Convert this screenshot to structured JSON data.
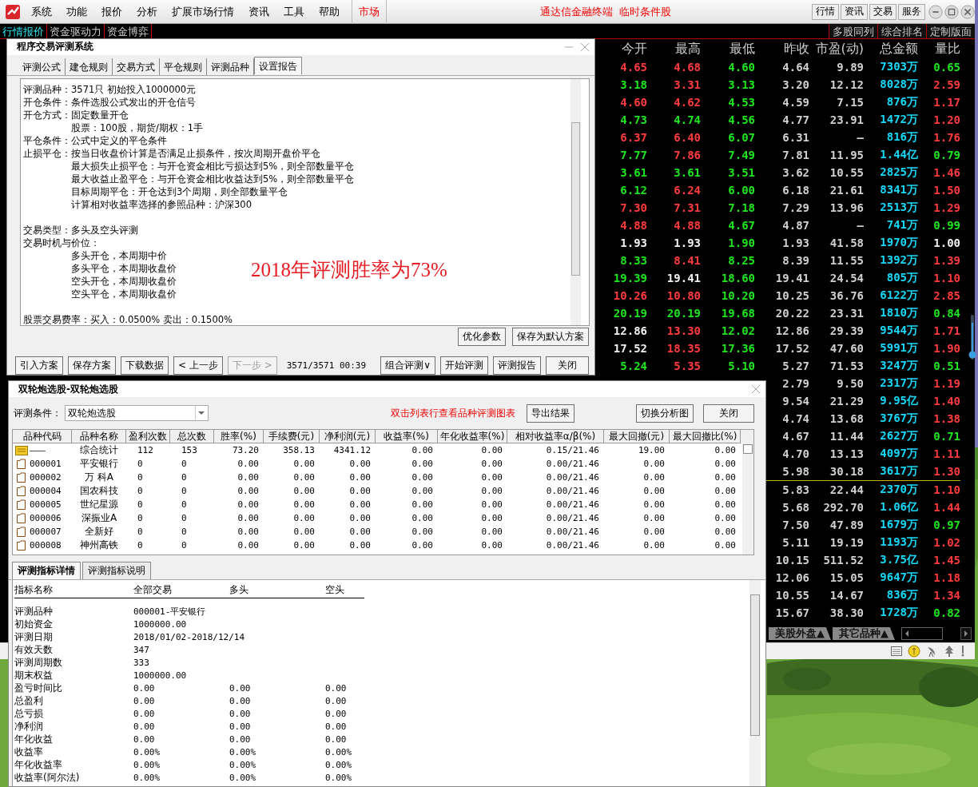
{
  "menu_bar": {
    "items": [
      "系统",
      "功能",
      "报价",
      "分析",
      "扩展市场行情",
      "资讯",
      "工具",
      "帮助"
    ],
    "market": "市场",
    "title": "通达信金融终端",
    "subtitle": "临时条件股",
    "buttons": [
      "行情",
      "资讯",
      "交易",
      "服务"
    ]
  },
  "view_tabs": [
    {
      "label": "行情报价",
      "selected": true
    },
    {
      "label": "资金驱动力",
      "selected": false
    },
    {
      "label": "资金博弈",
      "selected": false
    }
  ],
  "view_buttons": [
    "多股同列",
    "综合排名",
    "定制版面"
  ],
  "quote_table": {
    "columns": [
      "今开",
      "最高",
      "最低",
      "昨收",
      "市盈(动)",
      "总金额",
      "量比"
    ],
    "row_groups": [
      [
        {
          "open": {
            "text": "4.65",
            "color": "#ff3b3b"
          },
          "high": {
            "text": "4.68",
            "color": "#ff3b3b"
          },
          "low": {
            "text": "4.60",
            "color": "#1ee61e"
          },
          "prev_close": "4.64",
          "pe": "9.89",
          "amount": "7303万",
          "ratio": {
            "text": "0.65",
            "color": "#1ee61e"
          }
        },
        {
          "open": {
            "text": "3.18",
            "color": "#1ee61e"
          },
          "high": {
            "text": "3.31",
            "color": "#ff3b3b"
          },
          "low": {
            "text": "3.13",
            "color": "#1ee61e"
          },
          "prev_close": "3.20",
          "pe": "12.12",
          "amount": "8028万",
          "ratio": {
            "text": "2.59",
            "color": "#ff3b3b"
          }
        },
        {
          "open": {
            "text": "4.60",
            "color": "#ff3b3b"
          },
          "high": {
            "text": "4.62",
            "color": "#ff3b3b"
          },
          "low": {
            "text": "4.53",
            "color": "#1ee61e"
          },
          "prev_close": "4.59",
          "pe": "7.15",
          "amount": "876万",
          "ratio": {
            "text": "1.17",
            "color": "#ff3b3b"
          }
        },
        {
          "open": {
            "text": "4.73",
            "color": "#1ee61e"
          },
          "high": {
            "text": "4.74",
            "color": "#1ee61e"
          },
          "low": {
            "text": "4.56",
            "color": "#1ee61e"
          },
          "prev_close": "4.77",
          "pe": "23.91",
          "amount": "1472万",
          "ratio": {
            "text": "1.20",
            "color": "#ff3b3b"
          }
        },
        {
          "open": {
            "text": "6.37",
            "color": "#ff3b3b"
          },
          "high": {
            "text": "6.40",
            "color": "#ff3b3b"
          },
          "low": {
            "text": "6.07",
            "color": "#1ee61e"
          },
          "prev_close": "6.31",
          "pe": "—",
          "amount": "816万",
          "ratio": {
            "text": "1.76",
            "color": "#ff3b3b"
          }
        },
        {
          "open": {
            "text": "7.77",
            "color": "#1ee61e"
          },
          "high": {
            "text": "7.86",
            "color": "#ff3b3b"
          },
          "low": {
            "text": "7.49",
            "color": "#1ee61e"
          },
          "prev_close": "7.81",
          "pe": "11.95",
          "amount": "1.44亿",
          "ratio": {
            "text": "0.79",
            "color": "#1ee61e"
          }
        },
        {
          "open": {
            "text": "3.61",
            "color": "#1ee61e"
          },
          "high": {
            "text": "3.61",
            "color": "#1ee61e"
          },
          "low": {
            "text": "3.51",
            "color": "#1ee61e"
          },
          "prev_close": "3.62",
          "pe": "10.55",
          "amount": "2825万",
          "ratio": {
            "text": "1.46",
            "color": "#ff3b3b"
          }
        },
        {
          "open": {
            "text": "6.12",
            "color": "#1ee61e"
          },
          "high": {
            "text": "6.24",
            "color": "#ff3b3b"
          },
          "low": {
            "text": "6.00",
            "color": "#1ee61e"
          },
          "prev_close": "6.18",
          "pe": "21.61",
          "amount": "8341万",
          "ratio": {
            "text": "1.50",
            "color": "#ff3b3b"
          }
        },
        {
          "open": {
            "text": "7.30",
            "color": "#ff3b3b"
          },
          "high": {
            "text": "7.31",
            "color": "#ff3b3b"
          },
          "low": {
            "text": "7.18",
            "color": "#1ee61e"
          },
          "prev_close": "7.29",
          "pe": "13.96",
          "amount": "2513万",
          "ratio": {
            "text": "1.29",
            "color": "#ff3b3b"
          }
        },
        {
          "open": {
            "text": "4.88",
            "color": "#ff3b3b"
          },
          "high": {
            "text": "4.88",
            "color": "#ff3b3b"
          },
          "low": {
            "text": "4.67",
            "color": "#1ee61e"
          },
          "prev_close": "4.87",
          "pe": "—",
          "amount": "741万",
          "ratio": {
            "text": "0.99",
            "color": "#1ee61e"
          }
        },
        {
          "open": {
            "text": "1.93",
            "color": "#f0f0f0"
          },
          "high": {
            "text": "1.93",
            "color": "#f0f0f0"
          },
          "low": {
            "text": "1.90",
            "color": "#1ee61e"
          },
          "prev_close": "1.93",
          "pe": "41.58",
          "amount": "1970万",
          "ratio": {
            "text": "1.00",
            "color": "#f0f0f0"
          }
        },
        {
          "open": {
            "text": "8.33",
            "color": "#1ee61e"
          },
          "high": {
            "text": "8.41",
            "color": "#ff3b3b"
          },
          "low": {
            "text": "8.25",
            "color": "#1ee61e"
          },
          "prev_close": "8.39",
          "pe": "11.55",
          "amount": "1392万",
          "ratio": {
            "text": "1.39",
            "color": "#ff3b3b"
          }
        },
        {
          "open": {
            "text": "19.39",
            "color": "#1ee61e"
          },
          "high": {
            "text": "19.41",
            "color": "#f0f0f0"
          },
          "low": {
            "text": "18.60",
            "color": "#1ee61e"
          },
          "prev_close": "19.41",
          "pe": "24.54",
          "amount": "805万",
          "ratio": {
            "text": "1.10",
            "color": "#ff3b3b"
          }
        },
        {
          "open": {
            "text": "10.26",
            "color": "#ff3b3b"
          },
          "high": {
            "text": "10.80",
            "color": "#ff3b3b"
          },
          "low": {
            "text": "10.20",
            "color": "#1ee61e"
          },
          "prev_close": "10.25",
          "pe": "36.76",
          "amount": "6122万",
          "ratio": {
            "text": "2.85",
            "color": "#ff3b3b"
          }
        },
        {
          "open": {
            "text": "20.19",
            "color": "#1ee61e"
          },
          "high": {
            "text": "20.19",
            "color": "#1ee61e"
          },
          "low": {
            "text": "19.68",
            "color": "#1ee61e"
          },
          "prev_close": "20.22",
          "pe": "23.31",
          "amount": "1810万",
          "ratio": {
            "text": "0.84",
            "color": "#1ee61e"
          }
        },
        {
          "open": {
            "text": "12.86",
            "color": "#f0f0f0"
          },
          "high": {
            "text": "13.30",
            "color": "#ff3b3b"
          },
          "low": {
            "text": "12.02",
            "color": "#1ee61e"
          },
          "prev_close": "12.86",
          "pe": "29.39",
          "amount": "9544万",
          "ratio": {
            "text": "1.71",
            "color": "#ff3b3b"
          }
        },
        {
          "open": {
            "text": "17.52",
            "color": "#f0f0f0"
          },
          "high": {
            "text": "18.35",
            "color": "#ff3b3b"
          },
          "low": {
            "text": "17.36",
            "color": "#1ee61e"
          },
          "prev_close": "17.52",
          "pe": "47.60",
          "amount": "5991万",
          "ratio": {
            "text": "1.90",
            "color": "#ff3b3b"
          }
        },
        {
          "open": {
            "text": "5.24",
            "color": "#1ee61e"
          },
          "high": {
            "text": "5.35",
            "color": "#ff3b3b"
          },
          "low": {
            "text": "5.10",
            "color": "#1ee61e"
          },
          "prev_close": "5.27",
          "pe": "71.53",
          "amount": "3247万",
          "ratio": {
            "text": "0.51",
            "color": "#1ee61e"
          }
        },
        {
          "prev_close": "2.79",
          "pe": "9.50",
          "amount": "2317万",
          "ratio": {
            "text": "1.19",
            "color": "#ff3b3b"
          }
        },
        {
          "prev_close": "9.54",
          "pe": "21.29",
          "amount": "9.95亿",
          "ratio": {
            "text": "1.40",
            "color": "#ff3b3b"
          }
        },
        {
          "prev_close": "4.74",
          "pe": "13.68",
          "amount": "3767万",
          "ratio": {
            "text": "1.38",
            "color": "#ff3b3b"
          }
        },
        {
          "prev_close": "4.67",
          "pe": "11.44",
          "amount": "2627万",
          "ratio": {
            "text": "0.71",
            "color": "#1ee61e"
          }
        },
        {
          "prev_close": "4.70",
          "pe": "13.13",
          "amount": "4097万",
          "ratio": {
            "text": "1.11",
            "color": "#ff3b3b"
          }
        },
        {
          "prev_close": "5.98",
          "pe": "30.18",
          "amount": "3617万",
          "ratio": {
            "text": "1.30",
            "color": "#ff3b3b"
          }
        }
      ],
      [
        {
          "prev_close": "5.83",
          "pe": "22.44",
          "amount": "2370万",
          "ratio": {
            "text": "1.10",
            "color": "#ff3b3b"
          }
        },
        {
          "prev_close": "5.68",
          "pe": "292.70",
          "amount": "1.06亿",
          "ratio": {
            "text": "1.44",
            "color": "#ff3b3b"
          }
        },
        {
          "prev_close": "7.50",
          "pe": "47.89",
          "amount": "1679万",
          "ratio": {
            "text": "0.97",
            "color": "#1ee61e"
          }
        },
        {
          "prev_close": "5.11",
          "pe": "19.19",
          "amount": "1193万",
          "ratio": {
            "text": "1.02",
            "color": "#ff3b3b"
          }
        },
        {
          "prev_close": "10.15",
          "pe": "511.52",
          "amount": "3.75亿",
          "ratio": {
            "text": "1.45",
            "color": "#ff3b3b"
          }
        },
        {
          "prev_close": "12.06",
          "pe": "15.05",
          "amount": "9647万",
          "ratio": {
            "text": "1.18",
            "color": "#ff3b3b"
          }
        },
        {
          "prev_close": "10.55",
          "pe": "14.67",
          "amount": "836万",
          "ratio": {
            "text": "1.34",
            "color": "#ff3b3b"
          }
        },
        {
          "prev_close": "15.67",
          "pe": "38.30",
          "amount": "1728万",
          "ratio": {
            "text": "0.82",
            "color": "#1ee61e"
          }
        }
      ]
    ]
  },
  "market_tabs": [
    "美股外盘▲",
    "其它品种▲"
  ],
  "eval_window": {
    "title": "程序交易评测系统",
    "tabs": [
      {
        "label": "评测公式",
        "selected": false
      },
      {
        "label": "建仓规则",
        "selected": false
      },
      {
        "label": "交易方式",
        "selected": false
      },
      {
        "label": "平仓规则",
        "selected": false
      },
      {
        "label": "评测品种",
        "selected": false
      },
      {
        "label": "设置报告",
        "selected": true
      }
    ],
    "report_sections": [
      [
        {
          "text": "评测品种：3571只 初始投入1000000元"
        },
        {
          "text": "开仓条件：条件选股公式发出的开仓信号"
        },
        {
          "text": "开仓方式：固定数量开仓",
          "children": [
            {
              "text": "股票：100股，期货/期权：1手"
            }
          ]
        },
        {
          "text": "平仓条件：公式中定义的平仓条件"
        },
        {
          "text": "止损平仓：按当日收盘价计算是否满足止损条件，按次周期开盘价平仓",
          "children": [
            {
              "text": "最大损失止损平仓：与开仓资金相比亏损达到5%，则全部数量平仓"
            },
            {
              "text": "最大收益止盈平仓：与开仓资金相比收益达到5%，则全部数量平仓"
            },
            {
              "text": "目标周期平仓：开仓达到3个周期，则全部数量平仓"
            },
            {
              "text": "计算相对收益率选择的参照品种：沪深300"
            }
          ]
        }
      ],
      [
        {
          "text": "交易类型：多头及空头评测"
        },
        {
          "text": "交易时机与价位：",
          "children": [
            {
              "text": "多头开仓，本周期中价"
            },
            {
              "text": "多头平仓，本周期收盘价"
            },
            {
              "text": "空头开仓，本周期收盘价"
            },
            {
              "text": "空头平仓，本周期收盘价"
            }
          ]
        }
      ],
      [
        {
          "text": "股票交易费率：买入：0.0500%  卖出：0.1500%"
        }
      ]
    ],
    "annotation": "2018年评测胜率为73%",
    "panel_buttons": [
      "优化参数",
      "保存为默认方案"
    ],
    "toolbar": [
      {
        "label": "引入方案",
        "disabled": false
      },
      {
        "label": "保存方案",
        "disabled": false
      },
      {
        "label": "下载数据",
        "disabled": false
      },
      {
        "label": "< 上一步",
        "disabled": false
      },
      {
        "label": "下一步 >",
        "disabled": true
      }
    ],
    "progress": "3571/3571 00:39",
    "actions": [
      "组合评测∨",
      "开始评测",
      "评测报告",
      "关闭"
    ]
  },
  "select_window": {
    "title": "双轮炮选股-双轮炮选股",
    "condition_label": "评测条件：",
    "condition_value": "双轮炮选股",
    "hint": "双击列表行查看品种评测图表",
    "export_button": "导出结果",
    "right_buttons": [
      "切换分析图",
      "关闭"
    ],
    "columns": [
      "品种代码",
      "品种名称",
      "盈利次数",
      "总次数",
      "胜率(%)",
      "手续费(元)",
      "净利润(元)",
      "收益率(%)",
      "年化收益率(%)",
      "相对收益率α/β(%)",
      "最大回撤(元)",
      "最大回撤比(%)"
    ],
    "rows": [
      {
        "kind": "summary",
        "cells": [
          "———",
          "综合统计",
          "112",
          "153",
          "73.20",
          "358.13",
          "4341.12",
          "0.00",
          "0.00",
          "0.15/21.46",
          "19.00",
          "0.00"
        ]
      },
      {
        "kind": "stock",
        "cells": [
          "000001",
          "平安银行",
          "0",
          "0",
          "0.00",
          "0.00",
          "0.00",
          "0.00",
          "0.00",
          "0.00/21.46",
          "0.00",
          "0.00"
        ]
      },
      {
        "kind": "stock",
        "cells": [
          "000002",
          "万 科A",
          "0",
          "0",
          "0.00",
          "0.00",
          "0.00",
          "0.00",
          "0.00",
          "0.00/21.46",
          "0.00",
          "0.00"
        ]
      },
      {
        "kind": "stock",
        "cells": [
          "000004",
          "国农科技",
          "0",
          "0",
          "0.00",
          "0.00",
          "0.00",
          "0.00",
          "0.00",
          "0.00/21.46",
          "0.00",
          "0.00"
        ]
      },
      {
        "kind": "stock",
        "cells": [
          "000005",
          "世纪星源",
          "0",
          "0",
          "0.00",
          "0.00",
          "0.00",
          "0.00",
          "0.00",
          "0.00/21.46",
          "0.00",
          "0.00"
        ]
      },
      {
        "kind": "stock",
        "cells": [
          "000006",
          "深振业A",
          "0",
          "0",
          "0.00",
          "0.00",
          "0.00",
          "0.00",
          "0.00",
          "0.00/21.46",
          "0.00",
          "0.00"
        ]
      },
      {
        "kind": "stock",
        "cells": [
          "000007",
          "全新好",
          "0",
          "0",
          "0.00",
          "0.00",
          "0.00",
          "0.00",
          "0.00",
          "0.00/21.46",
          "0.00",
          "0.00"
        ]
      },
      {
        "kind": "stock",
        "cells": [
          "000008",
          "神州高铁",
          "0",
          "0",
          "0.00",
          "0.00",
          "0.00",
          "0.00",
          "0.00",
          "0.00/21.46",
          "0.00",
          "0.00"
        ]
      }
    ],
    "detail_tabs": [
      {
        "label": "评测指标详情",
        "selected": true
      },
      {
        "label": "评测指标说明",
        "selected": false
      }
    ],
    "detail_columns": [
      "指标名称",
      "全部交易",
      "多头",
      "空头"
    ],
    "detail_rows": [
      [
        "评测品种",
        "000001-平安银行"
      ],
      [
        "初始资金",
        "1000000.00"
      ],
      [
        "评测日期",
        "2018/01/02-2018/12/14"
      ],
      [
        "有效天数",
        "347"
      ],
      [
        "评测周期数",
        "333"
      ],
      [
        "期末权益",
        "1000000.00"
      ],
      [
        "盈亏时间比",
        "0.00",
        "0.00",
        "0.00"
      ],
      [
        "总盈利",
        "0.00",
        "0.00",
        "0.00"
      ],
      [
        "总亏损",
        "0.00",
        "0.00",
        "0.00"
      ],
      [
        "净利润",
        "0.00",
        "0.00",
        "0.00"
      ],
      [
        "年化收益",
        "0.00",
        "0.00",
        "0.00"
      ],
      [
        "收益率",
        "0.00%",
        "0.00%",
        "0.00%"
      ],
      [
        "年化收益率",
        "0.00%",
        "0.00%",
        "0.00%"
      ],
      [
        "收益率(阿尔法)",
        "0.00%",
        "0.00%",
        "0.00%"
      ]
    ]
  }
}
